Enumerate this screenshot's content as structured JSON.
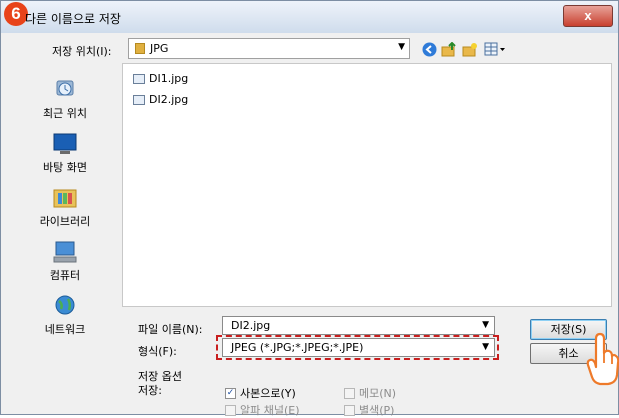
{
  "step_badge": "6",
  "window": {
    "title": "다른 이름으로 저장",
    "close_glyph": "x"
  },
  "location": {
    "label": "저장 위치(I):",
    "folder": "JPG"
  },
  "toolbar": {
    "icons": [
      "back-icon",
      "up-folder-icon",
      "new-folder-icon",
      "view-menu-icon"
    ]
  },
  "places": [
    {
      "label": "최근 위치",
      "icon": "recent-places-icon"
    },
    {
      "label": "바탕 화면",
      "icon": "desktop-icon"
    },
    {
      "label": "라이브러리",
      "icon": "libraries-icon"
    },
    {
      "label": "컴퓨터",
      "icon": "computer-icon"
    },
    {
      "label": "네트워크",
      "icon": "network-icon"
    }
  ],
  "files": [
    {
      "name": "DI1.jpg"
    },
    {
      "name": "DI2.jpg"
    }
  ],
  "filename": {
    "label": "파일 이름(N):",
    "value": "DI2.jpg"
  },
  "filetype": {
    "label": "형식(F):",
    "value": "JPEG (*.JPG;*.JPEG;*.JPE)"
  },
  "buttons": {
    "save": "저장(S)",
    "cancel": "취소"
  },
  "options": {
    "title": "저장 옵션",
    "save_label": "저장:",
    "checkboxes": [
      {
        "label": "사본으로(Y)",
        "checked": true,
        "enabled": true
      },
      {
        "label": "메모(N)",
        "checked": false,
        "enabled": false
      },
      {
        "label": "알파 채널(E)",
        "checked": false,
        "enabled": false
      },
      {
        "label": "별색(P)",
        "checked": false,
        "enabled": false
      }
    ]
  },
  "colors": {
    "highlight_dash": "#c81e1e",
    "badge": "#e8431a",
    "close_button": "#c8402f"
  }
}
